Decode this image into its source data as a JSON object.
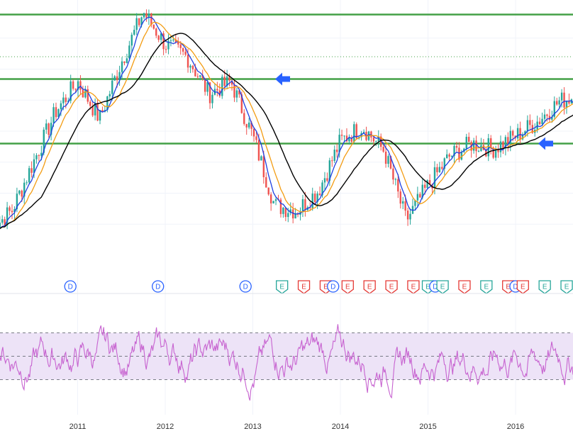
{
  "chart_data": [
    {
      "type": "candlestick",
      "panel": "price",
      "x_range": [
        "2010-01",
        "2016-09"
      ],
      "price_scale_visible": false,
      "grid": true,
      "series": [
        {
          "name": "",
          "kind": "candles",
          "x": [
            "2010-01",
            "2010-04",
            "2010-07",
            "2010-10",
            "2011-01",
            "2011-04",
            "2011-07",
            "2011-10",
            "2012-01",
            "2012-04",
            "2012-07",
            "2012-10",
            "2013-01",
            "2013-04",
            "2013-07",
            "2013-10",
            "2014-01",
            "2014-04",
            "2014-07",
            "2014-10",
            "2015-01",
            "2015-04",
            "2015-07",
            "2015-10",
            "2016-01",
            "2016-04",
            "2016-07",
            "2016-09"
          ],
          "close_rel": [
            0.1,
            0.18,
            0.38,
            0.58,
            0.7,
            0.55,
            0.78,
            0.98,
            0.85,
            0.8,
            0.65,
            0.7,
            0.48,
            0.2,
            0.18,
            0.26,
            0.46,
            0.52,
            0.42,
            0.14,
            0.28,
            0.4,
            0.45,
            0.43,
            0.48,
            0.54,
            0.62,
            0.64
          ]
        },
        {
          "name": "",
          "kind": "moving_average",
          "color": "#1e3fe0"
        },
        {
          "name": "",
          "kind": "moving_average",
          "color": "#f39c12"
        },
        {
          "name": "",
          "kind": "moving_average",
          "color": "#000000"
        }
      ],
      "horizontal_lines": [
        {
          "level_rel": 0.97,
          "color": "#43a047"
        },
        {
          "level_rel": 0.71,
          "color": "#43a047"
        },
        {
          "level_rel": 0.45,
          "color": "#43a047"
        },
        {
          "level_rel": 0.8,
          "color": "#43a047",
          "style": "dotted"
        }
      ],
      "arrows": [
        {
          "direction": "left",
          "color": "#2962ff",
          "at_line": 1
        },
        {
          "direction": "left",
          "color": "#2962ff",
          "at_line": 2
        }
      ],
      "event_badges": [
        {
          "label": "E",
          "kind": "earnings",
          "color": "#26a69a",
          "date": "2010-01"
        },
        {
          "label": "D",
          "kind": "dividend",
          "color": "#2962ff",
          "date": "2010-12"
        },
        {
          "label": "D",
          "kind": "dividend",
          "color": "#2962ff",
          "date": "2011-12"
        },
        {
          "label": "D",
          "kind": "dividend",
          "color": "#2962ff",
          "date": "2012-12"
        },
        {
          "label": "E",
          "kind": "earnings",
          "color": "#26a69a",
          "date": "2013-05"
        },
        {
          "label": "E",
          "kind": "earnings",
          "color": "#e53935",
          "date": "2013-08"
        },
        {
          "label": "E",
          "kind": "earnings",
          "color": "#e53935",
          "date": "2013-11"
        },
        {
          "label": "D",
          "kind": "dividend",
          "color": "#2962ff",
          "date": "2013-12"
        },
        {
          "label": "E",
          "kind": "earnings",
          "color": "#e53935",
          "date": "2014-02"
        },
        {
          "label": "E",
          "kind": "earnings",
          "color": "#e53935",
          "date": "2014-05"
        },
        {
          "label": "E",
          "kind": "earnings",
          "color": "#e53935",
          "date": "2014-08"
        },
        {
          "label": "E",
          "kind": "earnings",
          "color": "#e53935",
          "date": "2014-11"
        },
        {
          "label": "E",
          "kind": "earnings",
          "color": "#26a69a",
          "date": "2015-01"
        },
        {
          "label": "D",
          "kind": "dividend",
          "color": "#2962ff",
          "date": "2015-02"
        },
        {
          "label": "E",
          "kind": "earnings",
          "color": "#26a69a",
          "date": "2015-03"
        },
        {
          "label": "E",
          "kind": "earnings",
          "color": "#e53935",
          "date": "2015-06"
        },
        {
          "label": "E",
          "kind": "earnings",
          "color": "#26a69a",
          "date": "2015-09"
        },
        {
          "label": "E",
          "kind": "earnings",
          "color": "#e53935",
          "date": "2015-12"
        },
        {
          "label": "D",
          "kind": "dividend",
          "color": "#2962ff",
          "date": "2016-01"
        },
        {
          "label": "E",
          "kind": "earnings",
          "color": "#e53935",
          "date": "2016-02"
        },
        {
          "label": "E",
          "kind": "earnings",
          "color": "#26a69a",
          "date": "2016-05"
        },
        {
          "label": "E",
          "kind": "earnings",
          "color": "#26a69a",
          "date": "2016-08"
        }
      ]
    },
    {
      "type": "line",
      "panel": "oscillator",
      "color": "#c763d0",
      "band_fill": "#ede3f7",
      "band_levels": [
        70,
        50,
        30
      ],
      "ylim": [
        0,
        100
      ],
      "y_scale_visible": false
    }
  ],
  "time_axis": {
    "ticks": [
      "2011",
      "2012",
      "2013",
      "2014",
      "2015",
      "2016"
    ]
  },
  "colors": {
    "up": "#26a69a",
    "down": "#ef5350",
    "ma_fast": "#1e3fe0",
    "ma_mid": "#f39c12",
    "ma_slow": "#000000",
    "support_line": "#43a047",
    "arrow": "#2962ff",
    "oscillator": "#c763d0",
    "band": "#ede3f7"
  }
}
